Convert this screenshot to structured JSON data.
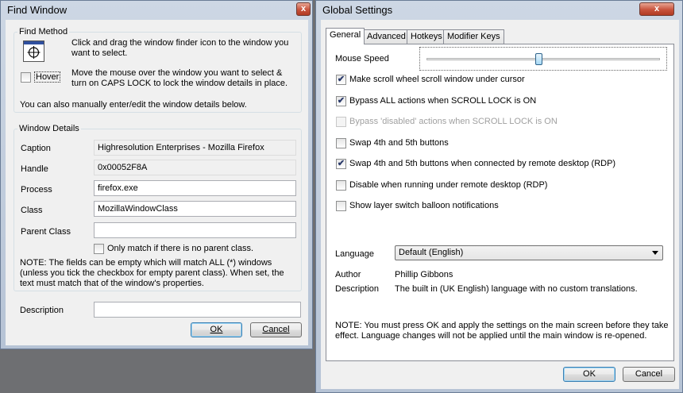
{
  "find_window": {
    "title": "Find Window",
    "close_label": "x",
    "find_method": {
      "group_label": "Find Method",
      "instruction1": "Click and drag the window finder icon to the window you want to select.",
      "hover_label": "Hover",
      "instruction2": "Move the mouse over the window you want to select & turn on CAPS LOCK to lock the window details in place.",
      "manual_text": "You can also manually enter/edit the window details below."
    },
    "details": {
      "group_label": "Window Details",
      "caption_label": "Caption",
      "caption_value": "Highresolution Enterprises - Mozilla Firefox",
      "handle_label": "Handle",
      "handle_value": "0x00052F8A",
      "process_label": "Process",
      "process_value": "firefox.exe",
      "class_label": "Class",
      "class_value": "MozillaWindowClass",
      "parent_class_label": "Parent Class",
      "parent_class_value": "",
      "only_match_label": "Only match if there is no parent class.",
      "note": "NOTE: The fields can be empty which will match ALL (*) windows (unless you tick the checkbox for empty parent class). When set, the text must match that of the window's properties."
    },
    "description_label": "Description",
    "description_value": "",
    "ok_label": "OK",
    "cancel_label": "Cancel"
  },
  "global_settings": {
    "title": "Global Settings",
    "close_label": "x",
    "tabs": [
      "General",
      "Advanced",
      "Hotkeys",
      "Modifier Keys"
    ],
    "mouse_speed_label": "Mouse Speed",
    "mouse_speed_level": 0.48,
    "options": [
      {
        "label": "Make scroll wheel scroll window under cursor",
        "checked": true,
        "disabled": false
      },
      {
        "label": "Bypass ALL actions when SCROLL LOCK is ON",
        "checked": true,
        "disabled": false
      },
      {
        "label": "Bypass 'disabled' actions when SCROLL LOCK is ON",
        "checked": false,
        "disabled": true
      },
      {
        "label": "Swap 4th and 5th buttons",
        "checked": false,
        "disabled": false
      },
      {
        "label": "Swap 4th and 5th buttons when connected by remote desktop (RDP)",
        "checked": true,
        "disabled": false
      },
      {
        "label": "Disable when running under remote desktop (RDP)",
        "checked": false,
        "disabled": false
      },
      {
        "label": "Show layer switch balloon notifications",
        "checked": false,
        "disabled": false
      }
    ],
    "language_label": "Language",
    "language_value": "Default (English)",
    "author_label": "Author",
    "author_value": "Phillip Gibbons",
    "description_label": "Description",
    "description_value": "The built in (UK English) language with no custom translations.",
    "note": "NOTE: You must press OK and apply the settings on the main screen before they take effect. Language changes will not be applied until the main window is re-opened.",
    "ok_label": "OK",
    "cancel_label": "Cancel",
    "check_mark": "✔"
  }
}
